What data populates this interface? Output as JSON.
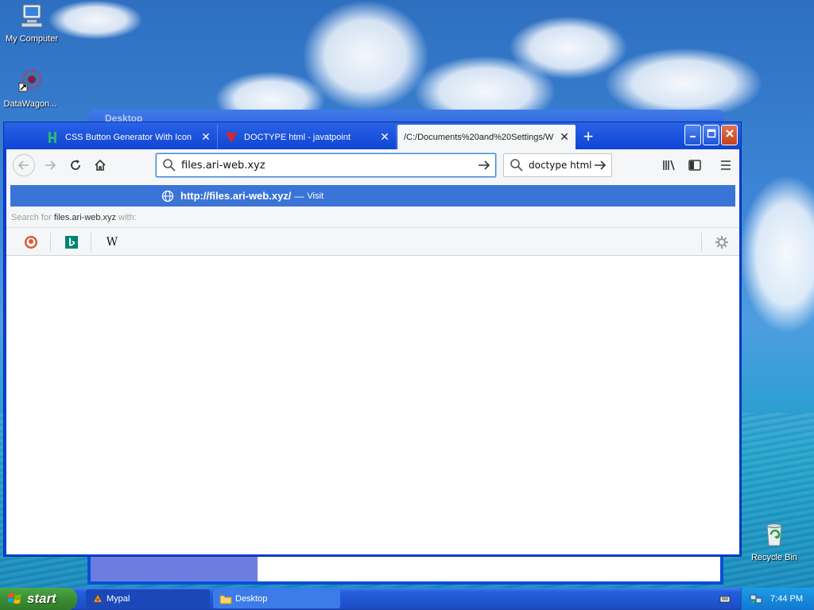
{
  "desktop": {
    "icons": [
      {
        "label": "My Computer",
        "icon": "my-computer-icon"
      },
      {
        "label": "DataWagon...",
        "icon": "datawagon-icon"
      },
      {
        "label": "Recycle Bin",
        "icon": "recycle-bin-icon"
      }
    ],
    "background_window": {
      "title": "Desktop"
    }
  },
  "browser": {
    "tabs": [
      {
        "label": "CSS Button Generator With Icon",
        "icon": "h-favicon-icon",
        "fav_color": "#2bb673",
        "close": "✕"
      },
      {
        "label": "DOCTYPE html - javatpoint",
        "icon": "javatpoint-favicon-icon",
        "fav_color": "#d62828",
        "close": "✕"
      },
      {
        "label": "/C:/Documents%20and%20Settings/W",
        "icon": "blank-page-icon",
        "close": "✕",
        "active": true
      }
    ],
    "new_tab": "+",
    "window_buttons": {
      "minimize": "_",
      "maximize": "□",
      "close": "✕"
    },
    "nav": {
      "back": "back-arrow-icon",
      "forward": "forward-arrow-icon",
      "reload": "reload-icon",
      "home": "home-icon"
    },
    "urlbar": {
      "value": "files.ari-web.xyz"
    },
    "searchbar": {
      "value": "doctype html"
    },
    "toolbar_right": [
      "library-icon",
      "sidebar-icon",
      "menu-icon"
    ],
    "dropdown": {
      "visit_url": "http://files.ari-web.xyz/",
      "visit_sep": "—",
      "visit_label": "Visit",
      "search_for_prefix": "Search for",
      "search_for_term": "files.ari-web.xyz",
      "search_for_suffix": "with:",
      "engines": [
        "duckduckgo-icon",
        "bing-icon",
        "wikipedia-icon"
      ],
      "wikipedia_glyph": "W",
      "settings": "gear-icon"
    }
  },
  "taskbar": {
    "start_label": "start",
    "items": [
      {
        "label": "Mypal",
        "icon": "mypal-icon"
      },
      {
        "label": "Desktop",
        "icon": "folder-icon"
      }
    ],
    "clock": "7:44 PM"
  },
  "colors": {
    "accent": "#3a74d6",
    "titlebar": "#1a4fdc",
    "taskbar": "#245edb",
    "start": "#3a8d33"
  }
}
